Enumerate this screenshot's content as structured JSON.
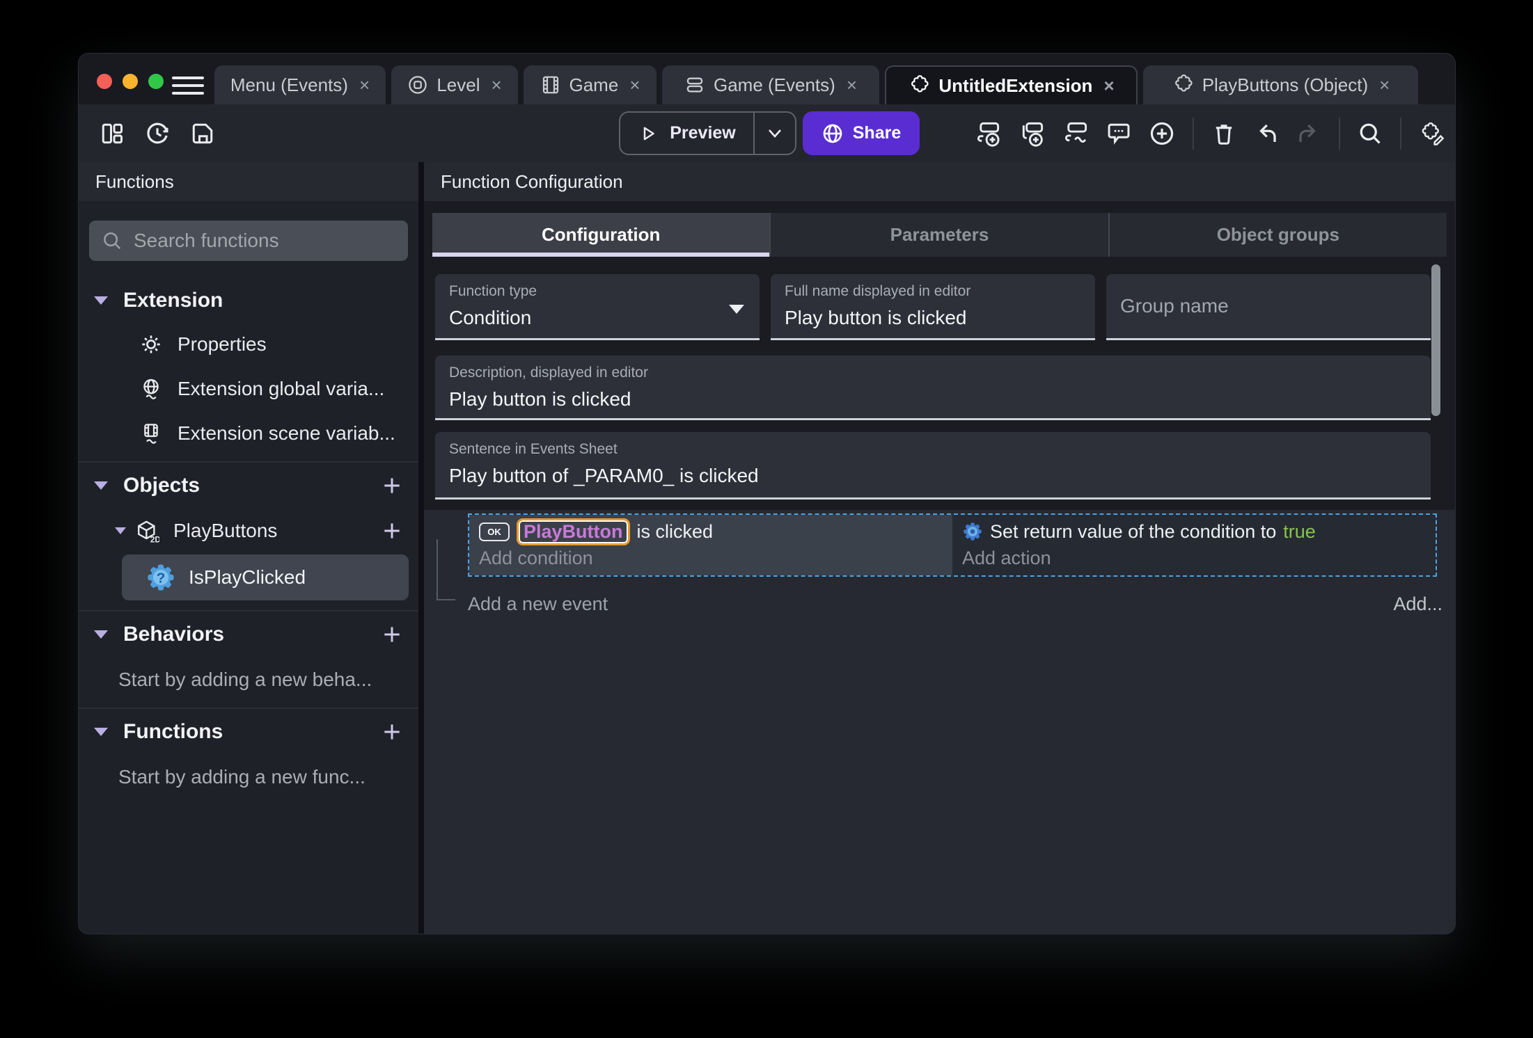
{
  "tabbar": {
    "close_glyph": "×",
    "tabs": [
      {
        "label": "Menu (Events)"
      },
      {
        "label": "Level",
        "icon": "scene-icon"
      },
      {
        "label": "Game",
        "icon": "film-icon"
      },
      {
        "label": "Game (Events)",
        "icon": "events-list-icon"
      },
      {
        "label": "UntitledExtension",
        "icon": "puzzle-icon",
        "active": true
      },
      {
        "label": "PlayButtons (Object)",
        "icon": "puzzle-icon"
      }
    ]
  },
  "toolbar": {
    "preview_label": "Preview",
    "share_label": "Share"
  },
  "sidebar": {
    "title": "Functions",
    "search_placeholder": "Search functions",
    "sections": {
      "extension": {
        "label": "Extension",
        "items": [
          {
            "label": "Properties"
          },
          {
            "label": "Extension global varia..."
          },
          {
            "label": "Extension scene variab..."
          }
        ]
      },
      "objects": {
        "label": "Objects",
        "object": {
          "label": "PlayButtons",
          "badge": "2D"
        },
        "function": {
          "label": "IsPlayClicked"
        }
      },
      "behaviors": {
        "label": "Behaviors",
        "empty_text": "Start by adding a new beha..."
      },
      "functions": {
        "label": "Functions",
        "empty_text": "Start by adding a new func..."
      }
    }
  },
  "main": {
    "title": "Function Configuration",
    "tabs": [
      {
        "label": "Configuration",
        "active": true
      },
      {
        "label": "Parameters"
      },
      {
        "label": "Object groups"
      }
    ],
    "fields": {
      "function_type": {
        "label": "Function type",
        "value": "Condition"
      },
      "full_name": {
        "label": "Full name displayed in editor",
        "value": "Play button is clicked"
      },
      "group_name": {
        "placeholder": "Group name"
      },
      "description": {
        "label": "Description, displayed in editor",
        "value": "Play button is clicked"
      },
      "sentence": {
        "label": "Sentence in Events Sheet",
        "value": "Play button of _PARAM0_ is clicked"
      }
    },
    "events": {
      "condition": {
        "button_icon_label": "OK",
        "object_name": "PlayButton",
        "text": "is clicked",
        "add_label": "Add condition"
      },
      "action": {
        "text": "Set return value of the condition to",
        "value": "true",
        "add_label": "Add action"
      },
      "add_event_label": "Add a new event",
      "add_more_label": "Add..."
    }
  },
  "colors": {
    "accent_purple": "#5a2dd3",
    "object_name_purple": "#c87ad7",
    "object_highlight_orange": "#e89b2e",
    "boolean_true_green": "#8bc34a",
    "selection_blue": "#4da3e0"
  }
}
